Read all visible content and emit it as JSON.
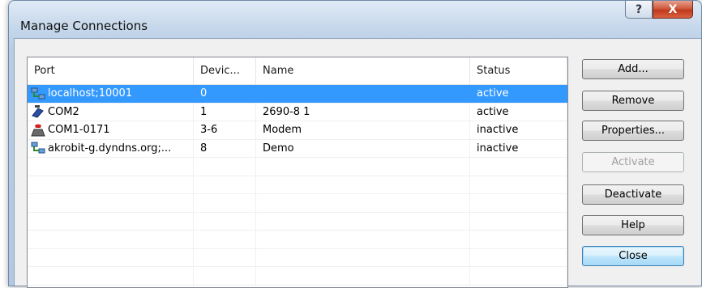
{
  "window": {
    "title": "Manage Connections",
    "help_glyph": "?",
    "close_glyph": "X"
  },
  "list": {
    "columns": [
      "Port",
      "Devic...",
      "Name",
      "Status"
    ],
    "rows": [
      {
        "port": "localhost;10001",
        "device": "0",
        "name": "",
        "status": "active",
        "icon": "network-icon",
        "selected": true
      },
      {
        "port": "COM2",
        "device": "1",
        "name": "2690-8 1",
        "status": "active",
        "icon": "serial-cable-icon",
        "selected": false
      },
      {
        "port": "COM1-0171",
        "device": "3-6",
        "name": "Modem",
        "status": "inactive",
        "icon": "modem-phone-icon",
        "selected": false
      },
      {
        "port": "akrobit-g.dyndns.org;...",
        "device": "8",
        "name": "Demo",
        "status": "inactive",
        "icon": "network-icon",
        "selected": false
      }
    ]
  },
  "buttons": {
    "add": "Add...",
    "remove": "Remove",
    "properties": "Properties...",
    "activate": "Activate",
    "deactivate": "Deactivate",
    "help": "Help",
    "close": "Close"
  },
  "colors": {
    "selection": "#3399ff",
    "window_frame": "#b9cde5",
    "close_button": "#c7432a"
  }
}
